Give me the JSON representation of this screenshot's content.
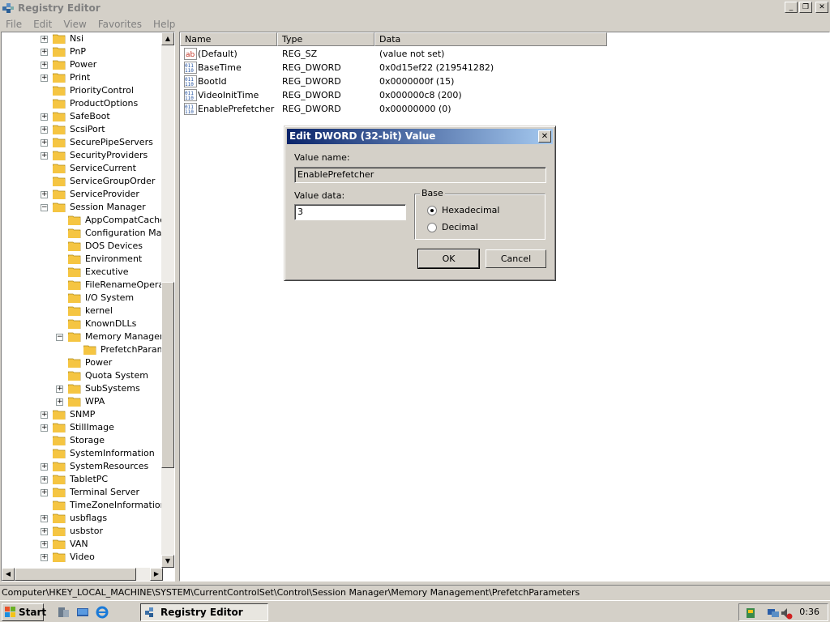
{
  "window": {
    "title": "Registry Editor"
  },
  "menu": [
    "File",
    "Edit",
    "View",
    "Favorites",
    "Help"
  ],
  "tree": [
    {
      "label": "Nsi",
      "level": 0,
      "exp": "+"
    },
    {
      "label": "PnP",
      "level": 0,
      "exp": "+"
    },
    {
      "label": "Power",
      "level": 0,
      "exp": "+"
    },
    {
      "label": "Print",
      "level": 0,
      "exp": "+"
    },
    {
      "label": "PriorityControl",
      "level": 0,
      "exp": ""
    },
    {
      "label": "ProductOptions",
      "level": 0,
      "exp": ""
    },
    {
      "label": "SafeBoot",
      "level": 0,
      "exp": "+"
    },
    {
      "label": "ScsiPort",
      "level": 0,
      "exp": "+"
    },
    {
      "label": "SecurePipeServers",
      "level": 0,
      "exp": "+"
    },
    {
      "label": "SecurityProviders",
      "level": 0,
      "exp": "+"
    },
    {
      "label": "ServiceCurrent",
      "level": 0,
      "exp": ""
    },
    {
      "label": "ServiceGroupOrder",
      "level": 0,
      "exp": ""
    },
    {
      "label": "ServiceProvider",
      "level": 0,
      "exp": "+"
    },
    {
      "label": "Session Manager",
      "level": 0,
      "exp": "-"
    },
    {
      "label": "AppCompatCache",
      "level": 1,
      "exp": ""
    },
    {
      "label": "Configuration Mana",
      "level": 1,
      "exp": ""
    },
    {
      "label": "DOS Devices",
      "level": 1,
      "exp": ""
    },
    {
      "label": "Environment",
      "level": 1,
      "exp": ""
    },
    {
      "label": "Executive",
      "level": 1,
      "exp": ""
    },
    {
      "label": "FileRenameOperatio",
      "level": 1,
      "exp": ""
    },
    {
      "label": "I/O System",
      "level": 1,
      "exp": ""
    },
    {
      "label": "kernel",
      "level": 1,
      "exp": ""
    },
    {
      "label": "KnownDLLs",
      "level": 1,
      "exp": ""
    },
    {
      "label": "Memory Manageme",
      "level": 1,
      "exp": "-"
    },
    {
      "label": "PrefetchParame",
      "level": 2,
      "exp": ""
    },
    {
      "label": "Power",
      "level": 1,
      "exp": ""
    },
    {
      "label": "Quota System",
      "level": 1,
      "exp": ""
    },
    {
      "label": "SubSystems",
      "level": 1,
      "exp": "+"
    },
    {
      "label": "WPA",
      "level": 1,
      "exp": "+"
    },
    {
      "label": "SNMP",
      "level": 0,
      "exp": "+"
    },
    {
      "label": "StillImage",
      "level": 0,
      "exp": "+"
    },
    {
      "label": "Storage",
      "level": 0,
      "exp": ""
    },
    {
      "label": "SystemInformation",
      "level": 0,
      "exp": ""
    },
    {
      "label": "SystemResources",
      "level": 0,
      "exp": "+"
    },
    {
      "label": "TabletPC",
      "level": 0,
      "exp": "+"
    },
    {
      "label": "Terminal Server",
      "level": 0,
      "exp": "+"
    },
    {
      "label": "TimeZoneInformation",
      "level": 0,
      "exp": ""
    },
    {
      "label": "usbflags",
      "level": 0,
      "exp": "+"
    },
    {
      "label": "usbstor",
      "level": 0,
      "exp": "+"
    },
    {
      "label": "VAN",
      "level": 0,
      "exp": "+"
    },
    {
      "label": "Video",
      "level": 0,
      "exp": "+"
    }
  ],
  "list": {
    "headers": [
      "Name",
      "Type",
      "Data"
    ],
    "rows": [
      {
        "name": "(Default)",
        "type": "REG_SZ",
        "data": "(value not set)",
        "icon": "string-value-icon"
      },
      {
        "name": "BaseTime",
        "type": "REG_DWORD",
        "data": "0x0d15ef22 (219541282)",
        "icon": "binary-value-icon"
      },
      {
        "name": "BootId",
        "type": "REG_DWORD",
        "data": "0x0000000f (15)",
        "icon": "binary-value-icon"
      },
      {
        "name": "VideoInitTime",
        "type": "REG_DWORD",
        "data": "0x000000c8 (200)",
        "icon": "binary-value-icon"
      },
      {
        "name": "EnablePrefetcher",
        "type": "REG_DWORD",
        "data": "0x00000000 (0)",
        "icon": "binary-value-icon"
      }
    ]
  },
  "dialog": {
    "title": "Edit DWORD (32-bit) Value",
    "value_name_label": "Value name:",
    "value_name": "EnablePrefetcher",
    "value_data_label": "Value data:",
    "value_data": "3",
    "base_label": "Base",
    "hex_label": "Hexadecimal",
    "dec_label": "Decimal",
    "base_selected": "Hexadecimal",
    "ok_label": "OK",
    "cancel_label": "Cancel",
    "close_glyph": "✕"
  },
  "statusbar": {
    "path": "Computer\\HKEY_LOCAL_MACHINE\\SYSTEM\\CurrentControlSet\\Control\\Session Manager\\Memory Management\\PrefetchParameters"
  },
  "taskbar": {
    "start_label": "Start",
    "task_label": "Registry Editor",
    "clock": "0:36"
  },
  "colors": {
    "title_gradient_start": "#0a246a",
    "title_gradient_end": "#a6caf0",
    "folder": "#f5c542"
  }
}
